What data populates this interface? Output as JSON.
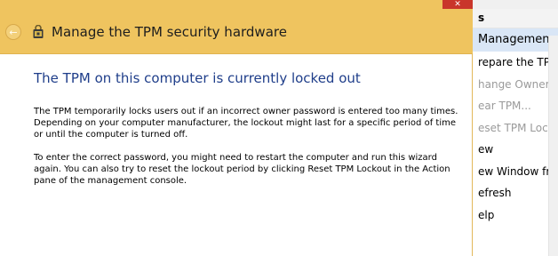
{
  "action_pane": {
    "heading": "s",
    "section": "Managemen...",
    "items": [
      {
        "label": "repare the TPM...",
        "disabled": false
      },
      {
        "label": "hange Owner P...",
        "disabled": true
      },
      {
        "label": "ear TPM...",
        "disabled": true
      },
      {
        "label": "eset TPM Locko...",
        "disabled": true
      },
      {
        "label": "ew",
        "disabled": false
      },
      {
        "label": "ew Window fro...",
        "disabled": false
      },
      {
        "label": "efresh",
        "disabled": false
      },
      {
        "label": "elp",
        "disabled": false
      }
    ]
  },
  "wizard": {
    "title": "Manage the TPM security hardware",
    "close_glyph": "✕",
    "back_glyph": "←",
    "heading": "The TPM on this computer is currently locked out",
    "paragraph1": "The TPM temporarily locks users out if an incorrect owner password is entered too many times.  Depending on your computer manufacturer, the lockout might last for a specific period of time or until the computer is turned off.",
    "paragraph2": "To enter the correct password, you might need to restart the computer and run this wizard again. You can also try to reset the lockout period by clicking Reset TPM Lockout in the Action pane of the management console."
  },
  "colors": {
    "header": "#efc45f",
    "heading_text": "#1f3e8a",
    "close": "#c9362b"
  }
}
